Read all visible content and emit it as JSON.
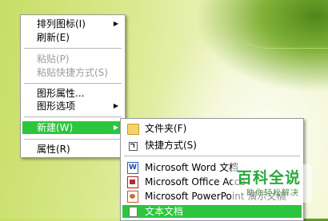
{
  "context_menu": {
    "items": [
      {
        "label": "排列图标(I)",
        "disabled": false,
        "submenu": true
      },
      {
        "label": "刷新(E)",
        "disabled": false,
        "submenu": false
      },
      {
        "label": "粘贴(P)",
        "disabled": true,
        "submenu": false
      },
      {
        "label": "粘贴快捷方式(S)",
        "disabled": true,
        "submenu": false
      },
      {
        "label": "图形属性...",
        "disabled": false,
        "submenu": false
      },
      {
        "label": "图形选项",
        "disabled": false,
        "submenu": true
      },
      {
        "label": "新建(W)",
        "disabled": false,
        "submenu": true,
        "active": true
      },
      {
        "label": "属性(R)",
        "disabled": false,
        "submenu": false
      }
    ],
    "active_color": "#2cc53e"
  },
  "new_submenu": {
    "items": [
      {
        "label": "文件夹(F)",
        "icon": "folder-icon"
      },
      {
        "label": "快捷方式(S)",
        "icon": "shortcut-icon"
      },
      {
        "label": "Microsoft Word 文档",
        "icon": "word-document-icon"
      },
      {
        "label": "Microsoft Office Acce",
        "icon": "access-database-icon"
      },
      {
        "label": "Microsoft PowerPoint 演示文稿",
        "icon": "powerpoint-icon"
      },
      {
        "label": "文本文档",
        "icon": "text-document-icon",
        "active": true
      }
    ]
  },
  "watermark": {
    "title": "百科全说",
    "subtitle": "助你轻松解决"
  }
}
